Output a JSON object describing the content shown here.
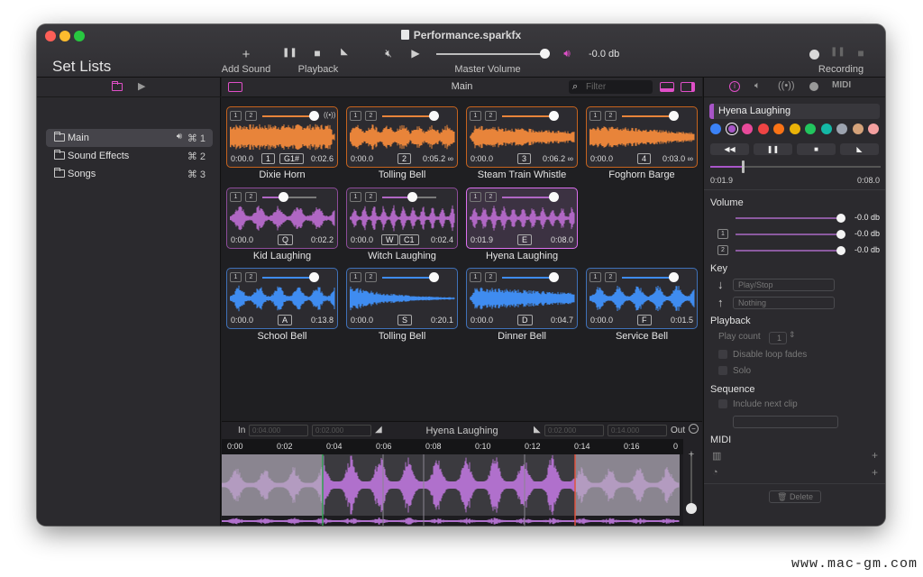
{
  "window": {
    "title": "Performance.sparkfx"
  },
  "toolbar": {
    "setlists_title": "Set Lists",
    "add_sound_label": "Add Sound",
    "playback_label": "Playback",
    "master_volume_label": "Master Volume",
    "master_volume_db": "-0.0 db",
    "recording_label": "Recording"
  },
  "sidebar": {
    "items": [
      {
        "label": "Main",
        "shortcut": "⌘ 1"
      },
      {
        "label": "Sound Effects",
        "shortcut": "⌘ 2"
      },
      {
        "label": "Songs",
        "shortcut": "⌘ 3"
      }
    ],
    "add_label": "+",
    "remove_label": "−"
  },
  "grid": {
    "title": "Main",
    "filter_placeholder": "Filter",
    "tiles": [
      {
        "name": "Dixie Horn",
        "color": "orange",
        "start": "0:00.0",
        "end": "0:02.6",
        "badges": [
          "1",
          "G1#"
        ],
        "volume": 0.95,
        "loop": true
      },
      {
        "name": "Tolling Bell",
        "color": "orange",
        "start": "0:00.0",
        "end": "0:05.2 ∞",
        "badges": [
          "2"
        ],
        "volume": 0.95
      },
      {
        "name": "Steam Train Whistle",
        "color": "orange",
        "start": "0:00.0",
        "end": "0:06.2 ∞",
        "badges": [
          "3"
        ],
        "volume": 0.95
      },
      {
        "name": "Foghorn Barge",
        "color": "orange",
        "start": "0:00.0",
        "end": "0:03.0 ∞",
        "badges": [
          "4"
        ],
        "volume": 0.95
      },
      {
        "name": "Kid Laughing",
        "color": "purple",
        "start": "0:00.0",
        "end": "0:02.2",
        "badges": [
          "Q"
        ],
        "volume": 0.38
      },
      {
        "name": "Witch Laughing",
        "color": "purple",
        "start": "0:00.0",
        "end": "0:02.4",
        "badges": [
          "W",
          "C1"
        ],
        "volume": 0.55
      },
      {
        "name": "Hyena Laughing",
        "color": "purple",
        "start": "0:01.9",
        "end": "0:08.0",
        "badges": [
          "E"
        ],
        "volume": 0.95,
        "selected": true
      },
      {
        "name": "School Bell",
        "color": "blue",
        "start": "0:00.0",
        "end": "0:13.8",
        "badges": [
          "A"
        ],
        "volume": 0.95
      },
      {
        "name": "Tolling Bell",
        "color": "blue",
        "start": "0:00.0",
        "end": "0:20.1",
        "badges": [
          "S"
        ],
        "volume": 0.95
      },
      {
        "name": "Dinner Bell",
        "color": "blue",
        "start": "0:00.0",
        "end": "0:04.7",
        "badges": [
          "D"
        ],
        "volume": 0.95
      },
      {
        "name": "Service Bell",
        "color": "blue",
        "start": "0:00.0",
        "end": "0:01.5",
        "badges": [
          "F"
        ],
        "volume": 0.95
      }
    ]
  },
  "editor": {
    "in_label": "In",
    "out_label": "Out",
    "clip_name": "Hyena Laughing",
    "in_fields": [
      "0:04.000",
      "0:02.000"
    ],
    "out_fields": [
      "0:02.000",
      "0:14.000"
    ],
    "ticks": [
      "0:00",
      "0:02",
      "0:04",
      "0:06",
      "0:08",
      "0:10",
      "0:12",
      "0:14",
      "0:16",
      "0"
    ]
  },
  "inspector": {
    "clip_name": "Hyena Laughing",
    "colors": [
      "#3b82f6",
      "#a855c8",
      "#e84a9a",
      "#ef4444",
      "#f97316",
      "#eab308",
      "#22c55e",
      "#14b8a6",
      "#9ca3af",
      "#d4a27a",
      "#f4a0a0"
    ],
    "transport": [
      "◀◀",
      "❚❚",
      "■",
      "◣"
    ],
    "position_start": "0:01.9",
    "position_end": "0:08.0",
    "volume_label": "Volume",
    "volume_rows": [
      {
        "badge": "",
        "db": "-0.0 db"
      },
      {
        "badge": "1",
        "db": "-0.0 db"
      },
      {
        "badge": "2",
        "db": "-0.0 db"
      }
    ],
    "key_label": "Key",
    "key_down": "Play/Stop",
    "key_up": "Nothing",
    "playback_label": "Playback",
    "play_count_label": "Play count",
    "play_count_value": "1",
    "disable_loop_fades": "Disable loop fades",
    "solo": "Solo",
    "sequence_label": "Sequence",
    "include_next_clip": "Include next clip",
    "midi_label": "MIDI",
    "delete_label": "Delete"
  },
  "watermark": "www.mac-gm.com"
}
